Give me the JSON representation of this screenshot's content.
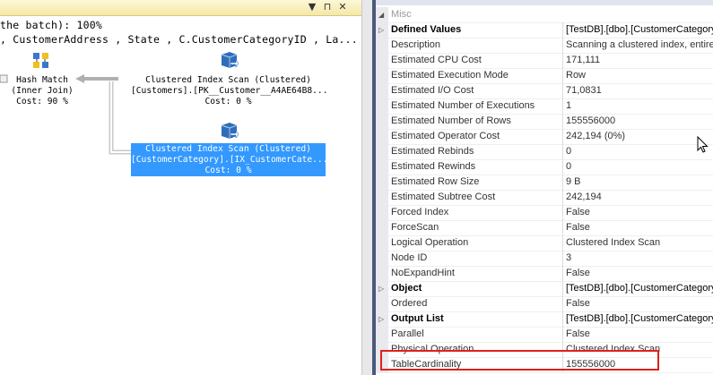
{
  "plan": {
    "line1": "the batch): 100%",
    "line2": ", CustomerAddress , State , C.CustomerCategoryID , La...",
    "nodes": [
      {
        "title": "Hash Match",
        "sub": "(Inner Join)",
        "cost": "Cost: 90 %",
        "icon": "hash-match-icon"
      },
      {
        "title": "Clustered Index Scan (Clustered)",
        "sub": "[Customers].[PK__Customer__A4AE64B8...",
        "cost": "Cost: 0 %",
        "icon": "clustered-index-scan-icon"
      },
      {
        "title": "Clustered Index Scan (Clustered)",
        "sub": "[CustomerCategory].[IX_CustomerCate...",
        "cost": "Cost: 0 %",
        "icon": "clustered-index-scan-icon"
      }
    ],
    "window_buttons": {
      "dropdown": "▼",
      "pin": "⊓",
      "close": "✕"
    }
  },
  "properties": {
    "category": "Misc",
    "rows": [
      {
        "name": "Defined Values",
        "value": "[TestDB].[dbo].[CustomerCategory",
        "bold": true,
        "expandable": true
      },
      {
        "name": "Description",
        "value": "Scanning a clustered index, entirely"
      },
      {
        "name": "Estimated CPU Cost",
        "value": "171,111"
      },
      {
        "name": "Estimated Execution Mode",
        "value": "Row"
      },
      {
        "name": "Estimated I/O Cost",
        "value": "71,0831"
      },
      {
        "name": "Estimated Number of Executions",
        "value": "1"
      },
      {
        "name": "Estimated Number of Rows",
        "value": "155556000"
      },
      {
        "name": "Estimated Operator Cost",
        "value": "242,194 (0%)"
      },
      {
        "name": "Estimated Rebinds",
        "value": "0"
      },
      {
        "name": "Estimated Rewinds",
        "value": "0"
      },
      {
        "name": "Estimated Row Size",
        "value": "9 B"
      },
      {
        "name": "Estimated Subtree Cost",
        "value": "242,194"
      },
      {
        "name": "Forced Index",
        "value": "False"
      },
      {
        "name": "ForceScan",
        "value": "False"
      },
      {
        "name": "Logical Operation",
        "value": "Clustered Index Scan"
      },
      {
        "name": "Node ID",
        "value": "3"
      },
      {
        "name": "NoExpandHint",
        "value": "False"
      },
      {
        "name": "Object",
        "value": "[TestDB].[dbo].[CustomerCategory",
        "bold": true,
        "expandable": true
      },
      {
        "name": "Ordered",
        "value": "False"
      },
      {
        "name": "Output List",
        "value": "[TestDB].[dbo].[CustomerCategory",
        "bold": true,
        "expandable": true
      },
      {
        "name": "Parallel",
        "value": "False"
      },
      {
        "name": "Physical Operation",
        "value": "Clustered Index Scan"
      },
      {
        "name": "TableCardinality",
        "value": "155556000"
      }
    ]
  },
  "colors": {
    "selection": "#3399ff",
    "highlight": "#e0201c"
  }
}
